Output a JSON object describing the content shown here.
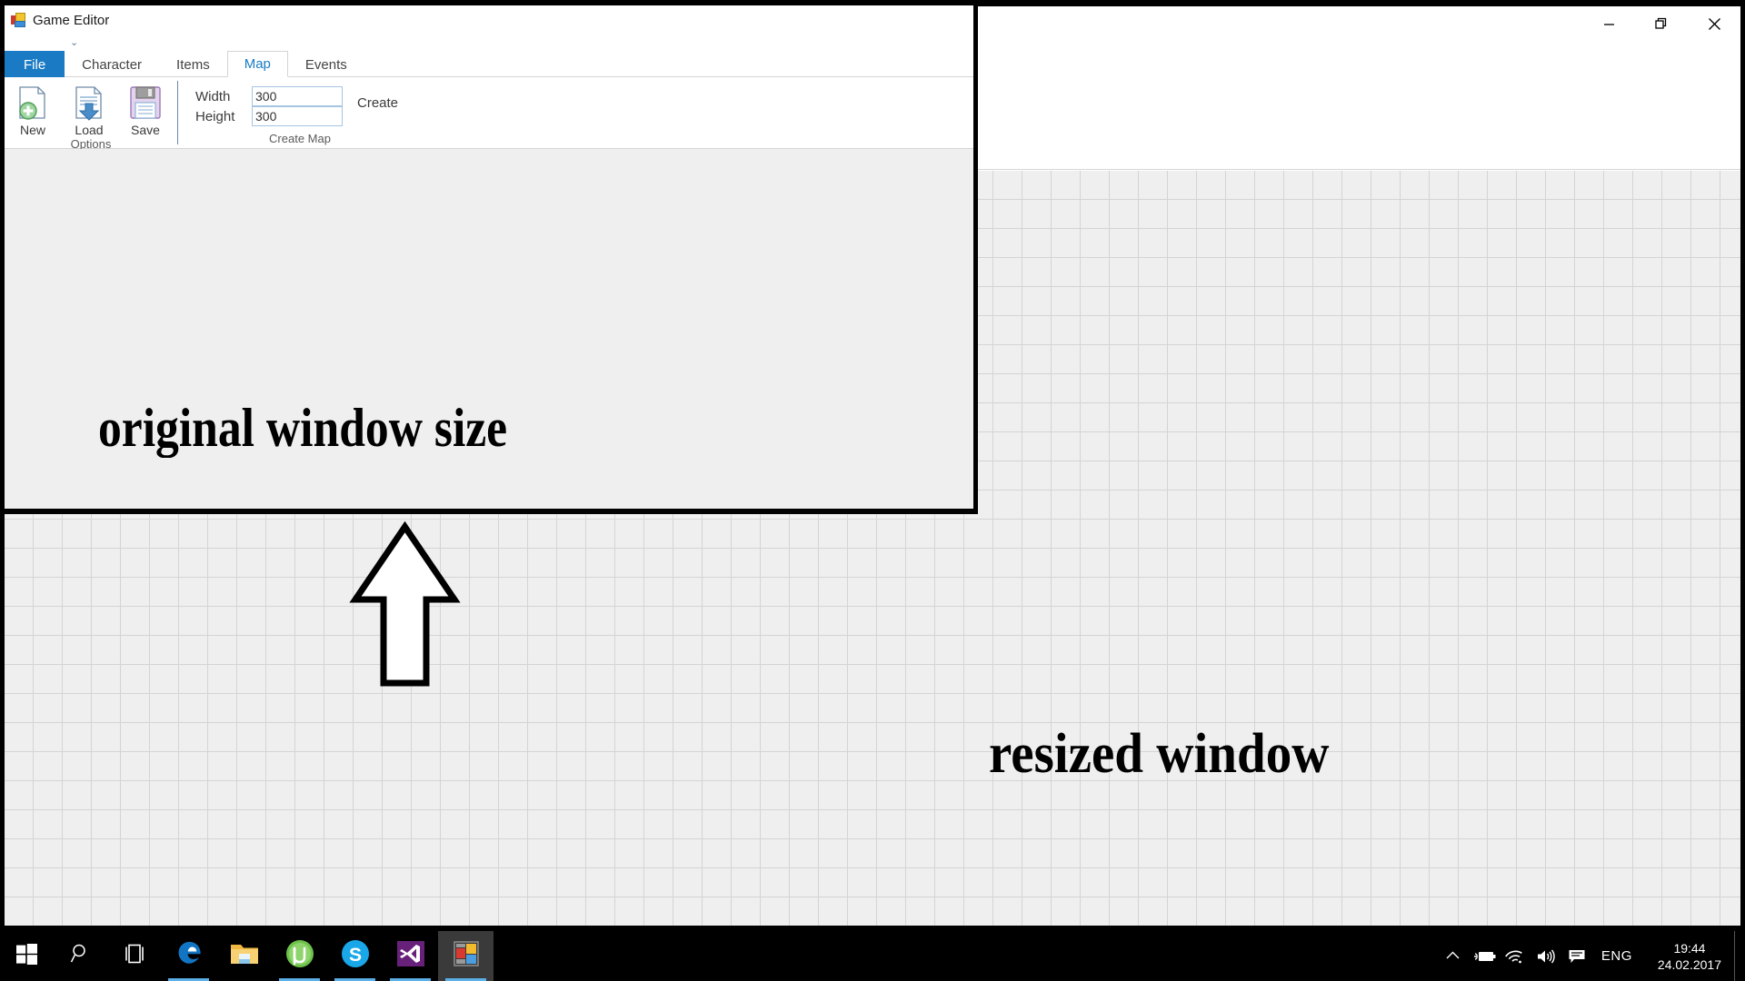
{
  "app": {
    "title": "Game Editor",
    "icon": "app-tiles-icon"
  },
  "window_controls": {
    "minimize": "minimize-icon",
    "restore": "restore-icon",
    "close": "close-icon"
  },
  "quick_access": {
    "customize_glyph": "⌄"
  },
  "ribbon": {
    "tabs": [
      {
        "label": "File",
        "state": "file"
      },
      {
        "label": "Character",
        "state": "normal"
      },
      {
        "label": "Items",
        "state": "normal"
      },
      {
        "label": "Map",
        "state": "active"
      },
      {
        "label": "Events",
        "state": "normal"
      }
    ],
    "groups": [
      {
        "label": "Options",
        "buttons": [
          {
            "label": "New",
            "icon": "new-document-icon"
          },
          {
            "label": "Load",
            "icon": "load-document-icon"
          },
          {
            "label": "Save",
            "icon": "floppy-disk-icon"
          }
        ]
      },
      {
        "label": "Create Map",
        "fields": [
          {
            "label": "Width",
            "value": "300",
            "placeholder": ""
          },
          {
            "label": "Height",
            "value": "300",
            "placeholder": ""
          }
        ],
        "action": "Create"
      }
    ]
  },
  "annotations": {
    "original": "original window size",
    "resized": "resized window",
    "arrow": "up-arrow-pointing-to-original-window"
  },
  "taskbar": {
    "items": [
      {
        "name": "start-button",
        "icon": "windows-logo-icon"
      },
      {
        "name": "search-button",
        "icon": "search-icon"
      },
      {
        "name": "task-view-button",
        "icon": "task-view-icon"
      },
      {
        "name": "edge-button",
        "icon": "edge-browser-icon",
        "running": true
      },
      {
        "name": "file-explorer-button",
        "icon": "folder-icon",
        "running": false
      },
      {
        "name": "utorrent-button",
        "icon": "utorrent-icon",
        "running": true
      },
      {
        "name": "skype-button",
        "icon": "skype-icon",
        "running": true
      },
      {
        "name": "visual-studio-button",
        "icon": "visual-studio-icon",
        "running": true
      },
      {
        "name": "game-editor-button",
        "icon": "app-tiles-icon",
        "running": true,
        "active": true
      }
    ],
    "tray": {
      "show_hidden": "chevron-up-icon",
      "power": "battery-icon",
      "network": "wifi-icon",
      "volume": "speaker-icon",
      "action_center": "notification-icon",
      "language": "ENG",
      "time": "19:44",
      "date": "24.02.2017"
    }
  },
  "colors": {
    "accent": "#1a7bc4",
    "tab_active_text": "#1a7bc4",
    "canvas": "#efefef",
    "grid_line": "#d4d4d4",
    "taskbar": "#000000",
    "underline": "#5bb0e8"
  }
}
